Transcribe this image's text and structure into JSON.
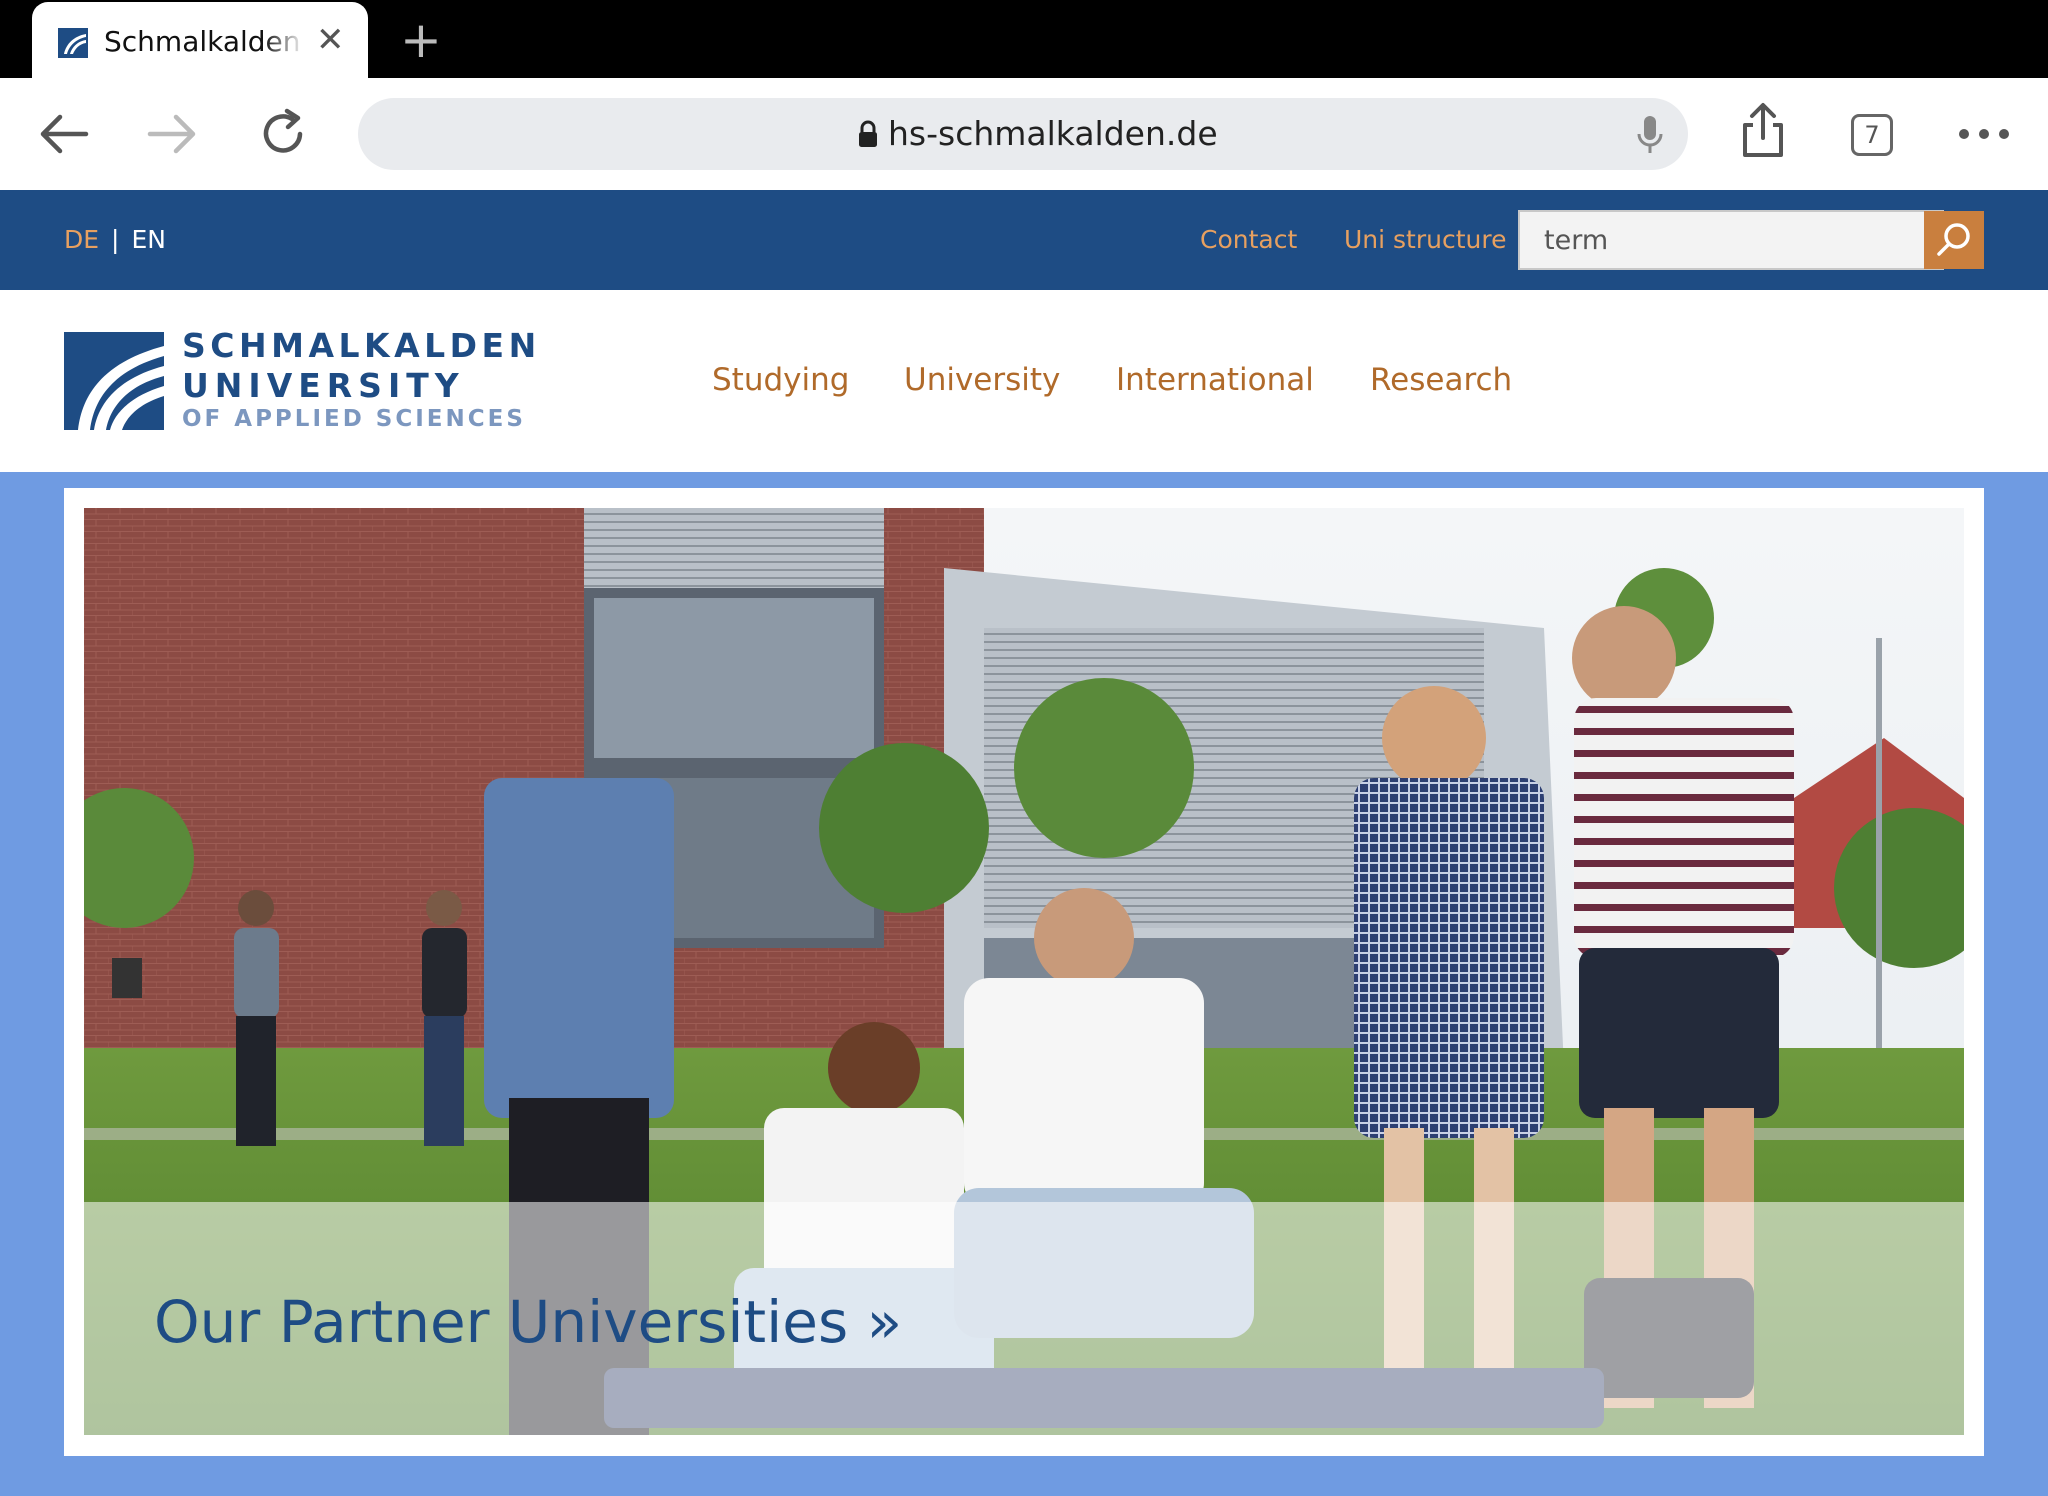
{
  "browser": {
    "tab_title": "Schmalkalden University of Applied Sciences",
    "new_tab": "+",
    "close": "✕",
    "url": "hs-schmalkalden.de",
    "tab_count": "7"
  },
  "topbar": {
    "lang_de": "DE",
    "lang_sep": "|",
    "lang_en": "EN",
    "contact": "Contact",
    "uni_structure": "Uni structure",
    "search_value": "term"
  },
  "logo": {
    "line1": "SCHMALKALDEN",
    "line2": "UNIVERSITY",
    "line3": "OF APPLIED SCIENCES"
  },
  "nav": {
    "studying": "Studying",
    "university": "University",
    "international": "International",
    "research": "Research"
  },
  "hero": {
    "link_text": "Our Partner Universities »"
  },
  "colors": {
    "brand_blue": "#1e4c84",
    "accent_orange": "#c97f3e",
    "page_blue": "#6f9be2"
  }
}
